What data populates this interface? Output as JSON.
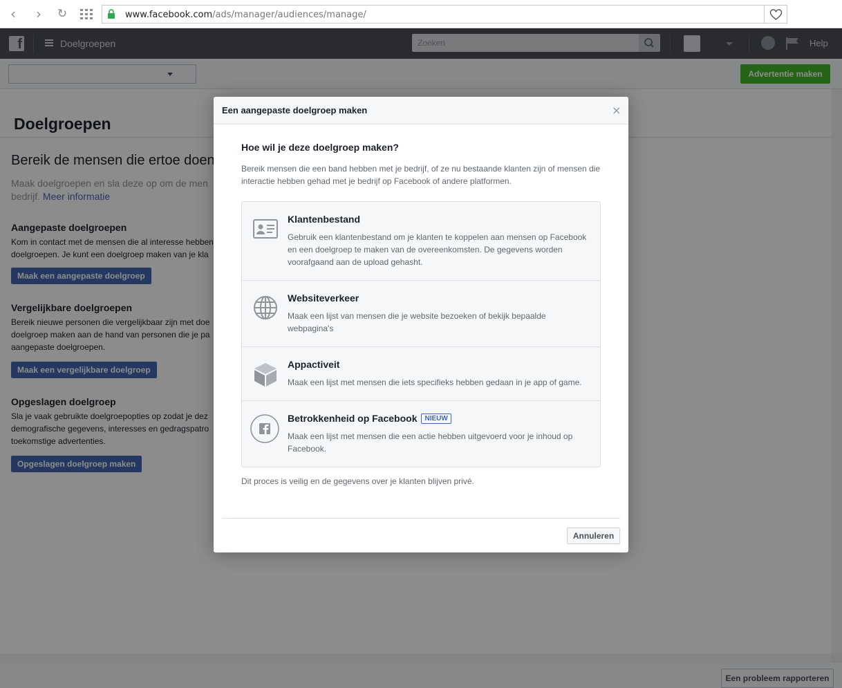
{
  "browser": {
    "url_host": "www.facebook.com",
    "url_path": "/ads/manager/audiences/manage/"
  },
  "fb_bar": {
    "title": "Doelgroepen",
    "search_placeholder": "Zoeken",
    "help_label": "Help"
  },
  "toolbar": {
    "create_ad_label": "Advertentie maken"
  },
  "page": {
    "title": "Doelgroepen",
    "hero_title": "Bereik de mensen die ertoe doen",
    "hero_sub": "Maak doelgroepen en sla deze op om de men",
    "hero_sub_line2": "bedrijf.",
    "hero_link": "Meer informatie",
    "sections": [
      {
        "title": "Aangepaste doelgroepen",
        "text": "Kom in contact met de mensen die al interesse hebben\ndoelgroepen. Je kunt een doelgroep maken van je kla",
        "button": "Maak een aangepaste doelgroep"
      },
      {
        "title": "Vergelijkbare doelgroepen",
        "text": "Bereik nieuwe personen die vergelijkbaar zijn met doe\ndoelgroep maken aan de hand van personen die je pa\naangepaste doelgroepen.",
        "button": "Maak een vergelijkbare doelgroep"
      },
      {
        "title": "Opgeslagen doelgroep",
        "text": "Sla je vaak gebruikte doelgroepopties op zodat je dez\ndemografische gegevens, interesses en gedragspatro\ntoekomstige advertenties.",
        "button": "Opgeslagen doelgroep maken"
      }
    ],
    "report_button": "Een probleem rapporteren"
  },
  "dialog": {
    "title": "Een aangepaste doelgroep maken",
    "close_glyph": "×",
    "question": "Hoe wil je deze doelgroep maken?",
    "description": "Bereik mensen die een band hebben met je bedrijf, of ze nu bestaande klanten zijn of mensen die interactie hebben gehad met je bedrijf op Facebook of andere platformen.",
    "options": [
      {
        "icon": "contact-card-icon",
        "title": "Klantenbestand",
        "badge": "",
        "description": "Gebruik een klantenbestand om je klanten te koppelen aan mensen op Facebook en een doelgroep te maken van de overeenkomsten. De gegevens worden voorafgaand aan de upload gehasht."
      },
      {
        "icon": "globe-icon",
        "title": "Websiteverkeer",
        "badge": "",
        "description": "Maak een lijst van mensen die je website bezoeken of bekijk bepaalde webpagina's"
      },
      {
        "icon": "cube-icon",
        "title": "Appactiveit",
        "badge": "",
        "description": "Maak een lijst met mensen die iets specifieks hebben gedaan in je app of game."
      },
      {
        "icon": "facebook-circle-icon",
        "title": "Betrokkenheid op Facebook",
        "badge": "NIEUW",
        "description": "Maak een lijst met mensen die een actie hebben uitgevoerd voor je inhoud op Facebook."
      }
    ],
    "secure_note": "Dit proces is veilig en de gegevens over je klanten blijven privé.",
    "cancel_label": "Annuleren"
  }
}
